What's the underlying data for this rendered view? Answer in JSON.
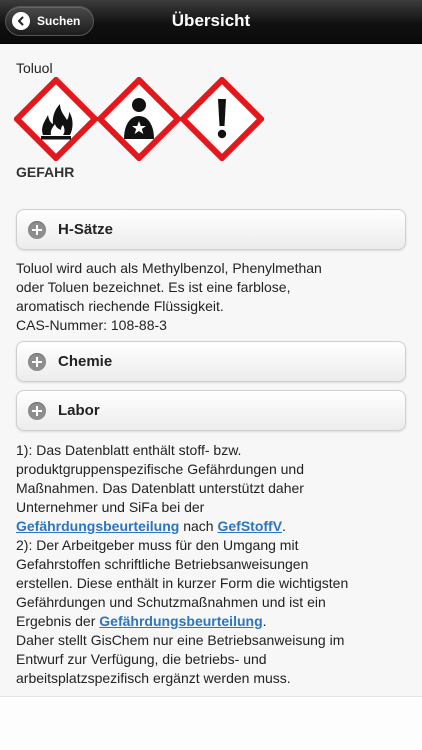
{
  "navbar": {
    "title": "Übersicht",
    "back_label": "Suchen"
  },
  "substance": {
    "name": "Toluol",
    "signal_word": "GEFAHR",
    "pictograms": [
      "flammable-icon",
      "health-hazard-icon",
      "exclamation-icon"
    ],
    "description": [
      "Toluol wird auch als Methylbenzol, Phenylmethan",
      "oder Toluen bezeichnet. Es ist eine farblose,",
      "aromatisch riechende Flüssigkeit.",
      "CAS-Nummer: 108-88-3"
    ]
  },
  "sections": [
    {
      "label": "H-Sätze"
    },
    {
      "label": "Chemie"
    },
    {
      "label": "Labor"
    }
  ],
  "notes": {
    "line1": "1): Das Datenblatt enthält stoff- bzw.",
    "line2": "produktgruppenspezifische Gefährdungen und",
    "line3": "Maßnahmen. Das Datenblatt unterstützt daher",
    "line4": "Unternehmer und SiFa bei der",
    "link_gb": "Gefährdungsbeurteilung",
    "word_nach": " nach ",
    "link_gefstoffv": "GefStoffV",
    "dot": ".",
    "line6": "2): Der Arbeitgeber muss für den Umgang mit",
    "line7": "Gefahrstoffen schriftliche Betriebsanweisungen",
    "line8": "erstellen. Diese enthält in kurzer Form die wichtigsten",
    "line9": "Gefährdungen und Schutzmaßnahmen und ist ein",
    "line10_prefix": "Ergebnis der ",
    "line10_link": "Gefährdungsbeurteilung",
    "line10_dot": ".",
    "line11": "Daher stellt GisChem nur eine Betriebsanweisung im",
    "line12": "Entwurf zur Verfügung, die betriebs- und",
    "line13": "arbeitsplatzspezifisch ergänzt werden muss."
  },
  "colors": {
    "ghs_red": "#e3181c",
    "link": "#2a76c0"
  }
}
